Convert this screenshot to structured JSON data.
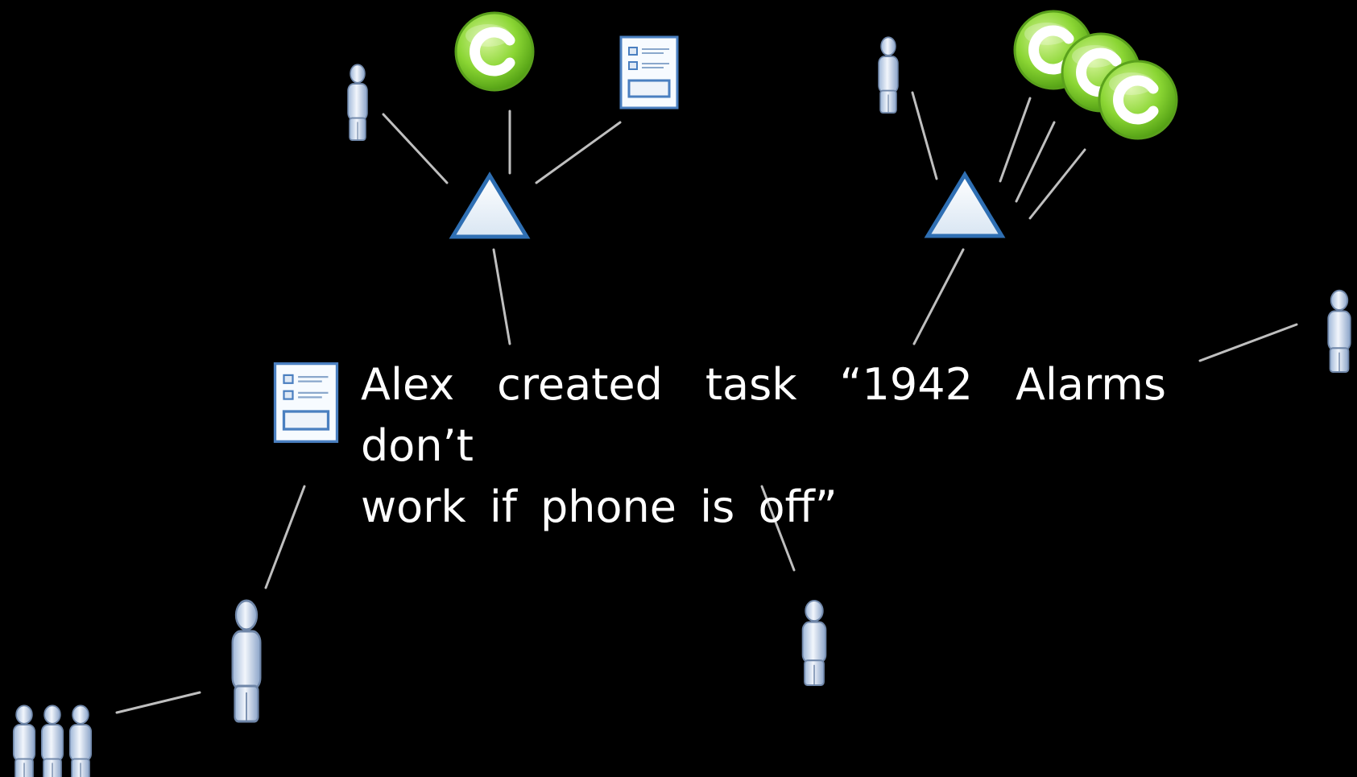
{
  "caption": {
    "line1": "Alex created task “1942 Alarms don’t",
    "line2": "work if phone is off”"
  },
  "icon_legend": {
    "person": "person-icon",
    "group": "group-icon",
    "task": "task-icon",
    "commit": "commit-icon",
    "hub": "triangle-node-icon",
    "commit_letter": "C"
  },
  "colors": {
    "background": "#000000",
    "edge": "#bfbfbf",
    "caption_text": "#ffffff",
    "commit_green": "#7fd12a",
    "hub_blue": "#2f6fb3"
  }
}
